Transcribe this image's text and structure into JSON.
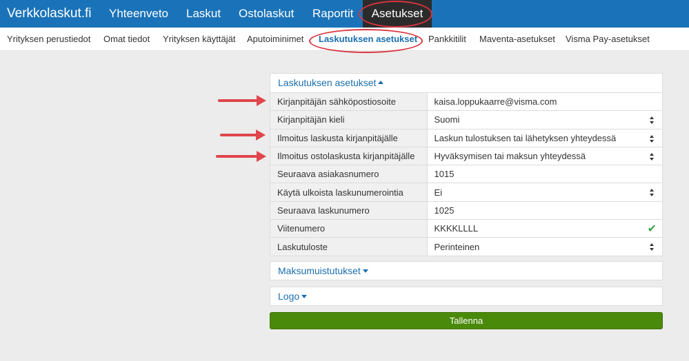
{
  "app": {
    "brand": "Verkkolaskut.fi"
  },
  "topnav": [
    "Yhteenveto",
    "Laskut",
    "Ostolaskut",
    "Raportit",
    "Asetukset"
  ],
  "subnav": [
    "Yrityksen perustiedot",
    "Omat tiedot",
    "Yrityksen käyttäjät",
    "Aputoiminimet",
    "Laskutuksen asetukset",
    "Pankkitilit",
    "Maventa-asetukset",
    "Visma Pay-asetukset"
  ],
  "billing": {
    "title": "Laskutuksen asetukset",
    "rows": [
      {
        "label": "Kirjanpitäjän sähköpostiosoite",
        "value": "kaisa.loppukaarre@visma.com",
        "control": "text"
      },
      {
        "label": "Kirjanpitäjän kieli",
        "value": "Suomi",
        "control": "select"
      },
      {
        "label": "Ilmoitus laskusta kirjanpitäjälle",
        "value": "Laskun tulostuksen tai lähetyksen yhteydessä",
        "control": "select"
      },
      {
        "label": "Ilmoitus ostolaskusta kirjanpitäjälle",
        "value": "Hyväksymisen tai maksun yhteydessä",
        "control": "select"
      },
      {
        "label": "Seuraava asiakasnumero",
        "value": "1015",
        "control": "text"
      },
      {
        "label": "Käytä ulkoista laskunumerointia",
        "value": "Ei",
        "control": "select"
      },
      {
        "label": "Seuraava laskunumero",
        "value": "1025",
        "control": "text"
      },
      {
        "label": "Viitenumero",
        "value": "KKKKLLLL",
        "control": "validated"
      },
      {
        "label": "Laskutuloste",
        "value": "Perinteinen",
        "control": "select"
      }
    ]
  },
  "payment_reminders": {
    "title": "Maksumuistutukset"
  },
  "logo": {
    "title": "Logo"
  },
  "save_label": "Tallenna",
  "colors": {
    "topbar": "#1a73b8",
    "link": "#1a6fb0",
    "save": "#4a8a0a",
    "annotation": "#e0454b"
  }
}
